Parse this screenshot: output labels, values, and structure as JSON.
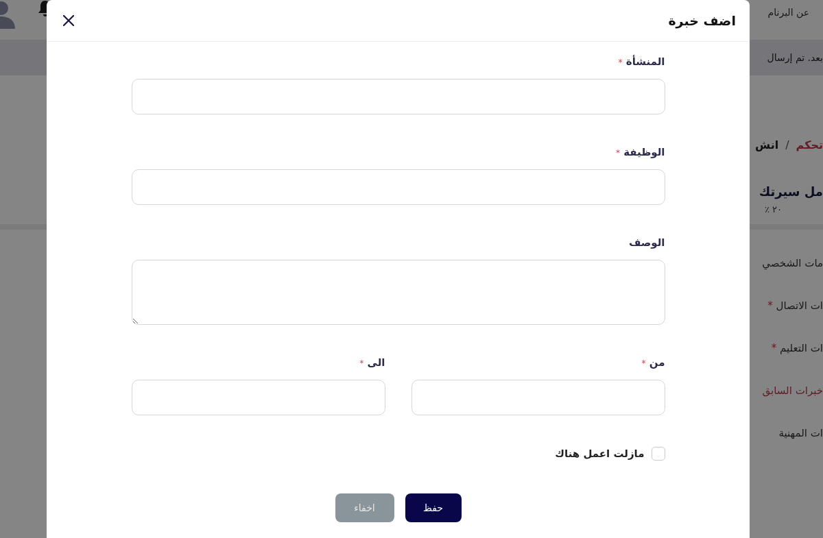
{
  "background": {
    "header_link": "عن البرنام",
    "banner": "بعد. تم إرسال",
    "breadcrumb": [
      {
        "label": "تحكم",
        "kind": "link"
      },
      {
        "label": "/",
        "kind": "separator"
      },
      {
        "label": "انش",
        "kind": "current"
      }
    ],
    "heading": "مل سيرتك",
    "progress_text": "٢٠ ٪",
    "sidebar": {
      "items": [
        {
          "label": "مات الشخصي",
          "selected": false
        },
        {
          "label": "ات الاتصال",
          "mark": "*",
          "selected": false
        },
        {
          "label": "ات التعليم",
          "mark": "*",
          "selected": false
        },
        {
          "label": "خبرات السابق",
          "selected": true
        },
        {
          "label": "ات المهنية",
          "selected": false
        }
      ]
    }
  },
  "dialog": {
    "title": "اضف خبرة",
    "rows": [
      [
        {
          "label": "المنشأة",
          "mark": "*",
          "kind": "text"
        }
      ],
      [
        {
          "label": "الوظيفة",
          "mark": "*",
          "kind": "text"
        }
      ],
      [
        {
          "label": "الوصف",
          "kind": "textarea"
        }
      ],
      [
        {
          "label": "من",
          "mark": "*",
          "kind": "text"
        },
        {
          "label": "الى",
          "mark": "*",
          "kind": "text"
        }
      ]
    ],
    "checkbox": {
      "label": "مازلت اعمل هناك",
      "checked": false
    },
    "buttons": [
      {
        "label": "حفظ",
        "kind": "primary"
      },
      {
        "label": "اخفاء",
        "kind": "secondary"
      }
    ]
  }
}
